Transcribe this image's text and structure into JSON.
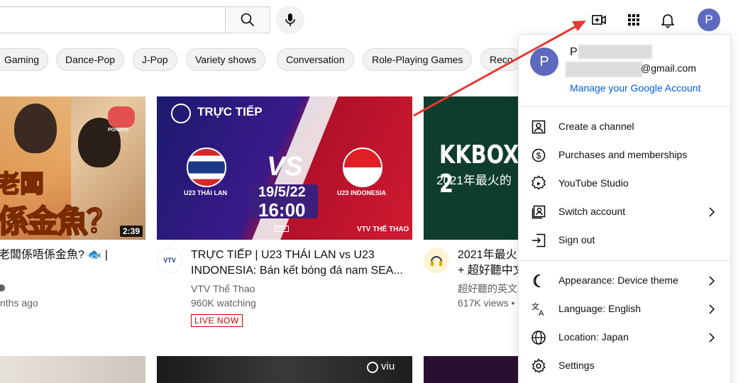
{
  "chips": [
    "Gaming",
    "Dance-Pop",
    "J-Pop",
    "Variety shows",
    "Conversation",
    "Role-Playing Games",
    "Reco"
  ],
  "videos": [
    {
      "duration": "2:39",
      "thumb_text_top": "老闆",
      "thumb_text_bottom": "係金魚？",
      "thumb_logo": "PONATO",
      "title": "老闆係唔係金魚? 🐟 |",
      "meta1": "",
      "meta2": "nths ago"
    },
    {
      "thumb_live_label": "TRỰC TIẾP",
      "thumb_vs": "VS",
      "thumb_date": "19/5/22",
      "thumb_time": "16:00",
      "thumb_team_left": "U23 THÁI LAN",
      "thumb_team_right": "U23 INDONESIA",
      "thumb_brand": "VTV THỂ THAO",
      "thumb_vtv": "VTV",
      "channel_avatar_text": "VTV",
      "title_line1": "TRỰC TIẾP | U23 THÁI LAN vs U23",
      "title_line2": "INDONESIA: Bán kết bóng đá nam SEA...",
      "channel": "VTV Thể Thao",
      "watching": "960K watching",
      "live_badge": "LIVE NOW"
    },
    {
      "thumb_title": "KKBOX 2",
      "thumb_sub": "2021年最火的",
      "title_line1": "2021年最火",
      "title_line2": "+ 超好聽中文",
      "channel": "超好聽的英文",
      "views": "617K views •"
    }
  ],
  "bottom_row": {
    "viu": "viu"
  },
  "topbar": {
    "search_placeholder": "",
    "avatar_letter": "P"
  },
  "account_menu": {
    "avatar_letter": "P",
    "name_initial": "P",
    "email_suffix": "@gmail.com",
    "manage_link": "Manage your Google Account",
    "items": [
      {
        "label": "Create a channel",
        "icon": "person-square-icon"
      },
      {
        "label": "Purchases and memberships",
        "icon": "dollar-circle-icon"
      },
      {
        "label": "YouTube Studio",
        "icon": "studio-gear-play-icon"
      },
      {
        "label": "Switch account",
        "icon": "switch-account-icon",
        "chevron": true
      },
      {
        "label": "Sign out",
        "icon": "sign-out-icon"
      },
      {
        "label": "Appearance: Device theme",
        "icon": "moon-icon",
        "chevron": true
      },
      {
        "label": "Language: English",
        "icon": "translate-icon",
        "chevron": true
      },
      {
        "label": "Location: Japan",
        "icon": "globe-icon",
        "chevron": true
      },
      {
        "label": "Settings",
        "icon": "gear-icon"
      }
    ]
  },
  "colors": {
    "accent_blue": "#065fd4",
    "avatar": "#5c6bc0",
    "live_red": "#cc0000",
    "annotation_arrow": "#e53935"
  }
}
